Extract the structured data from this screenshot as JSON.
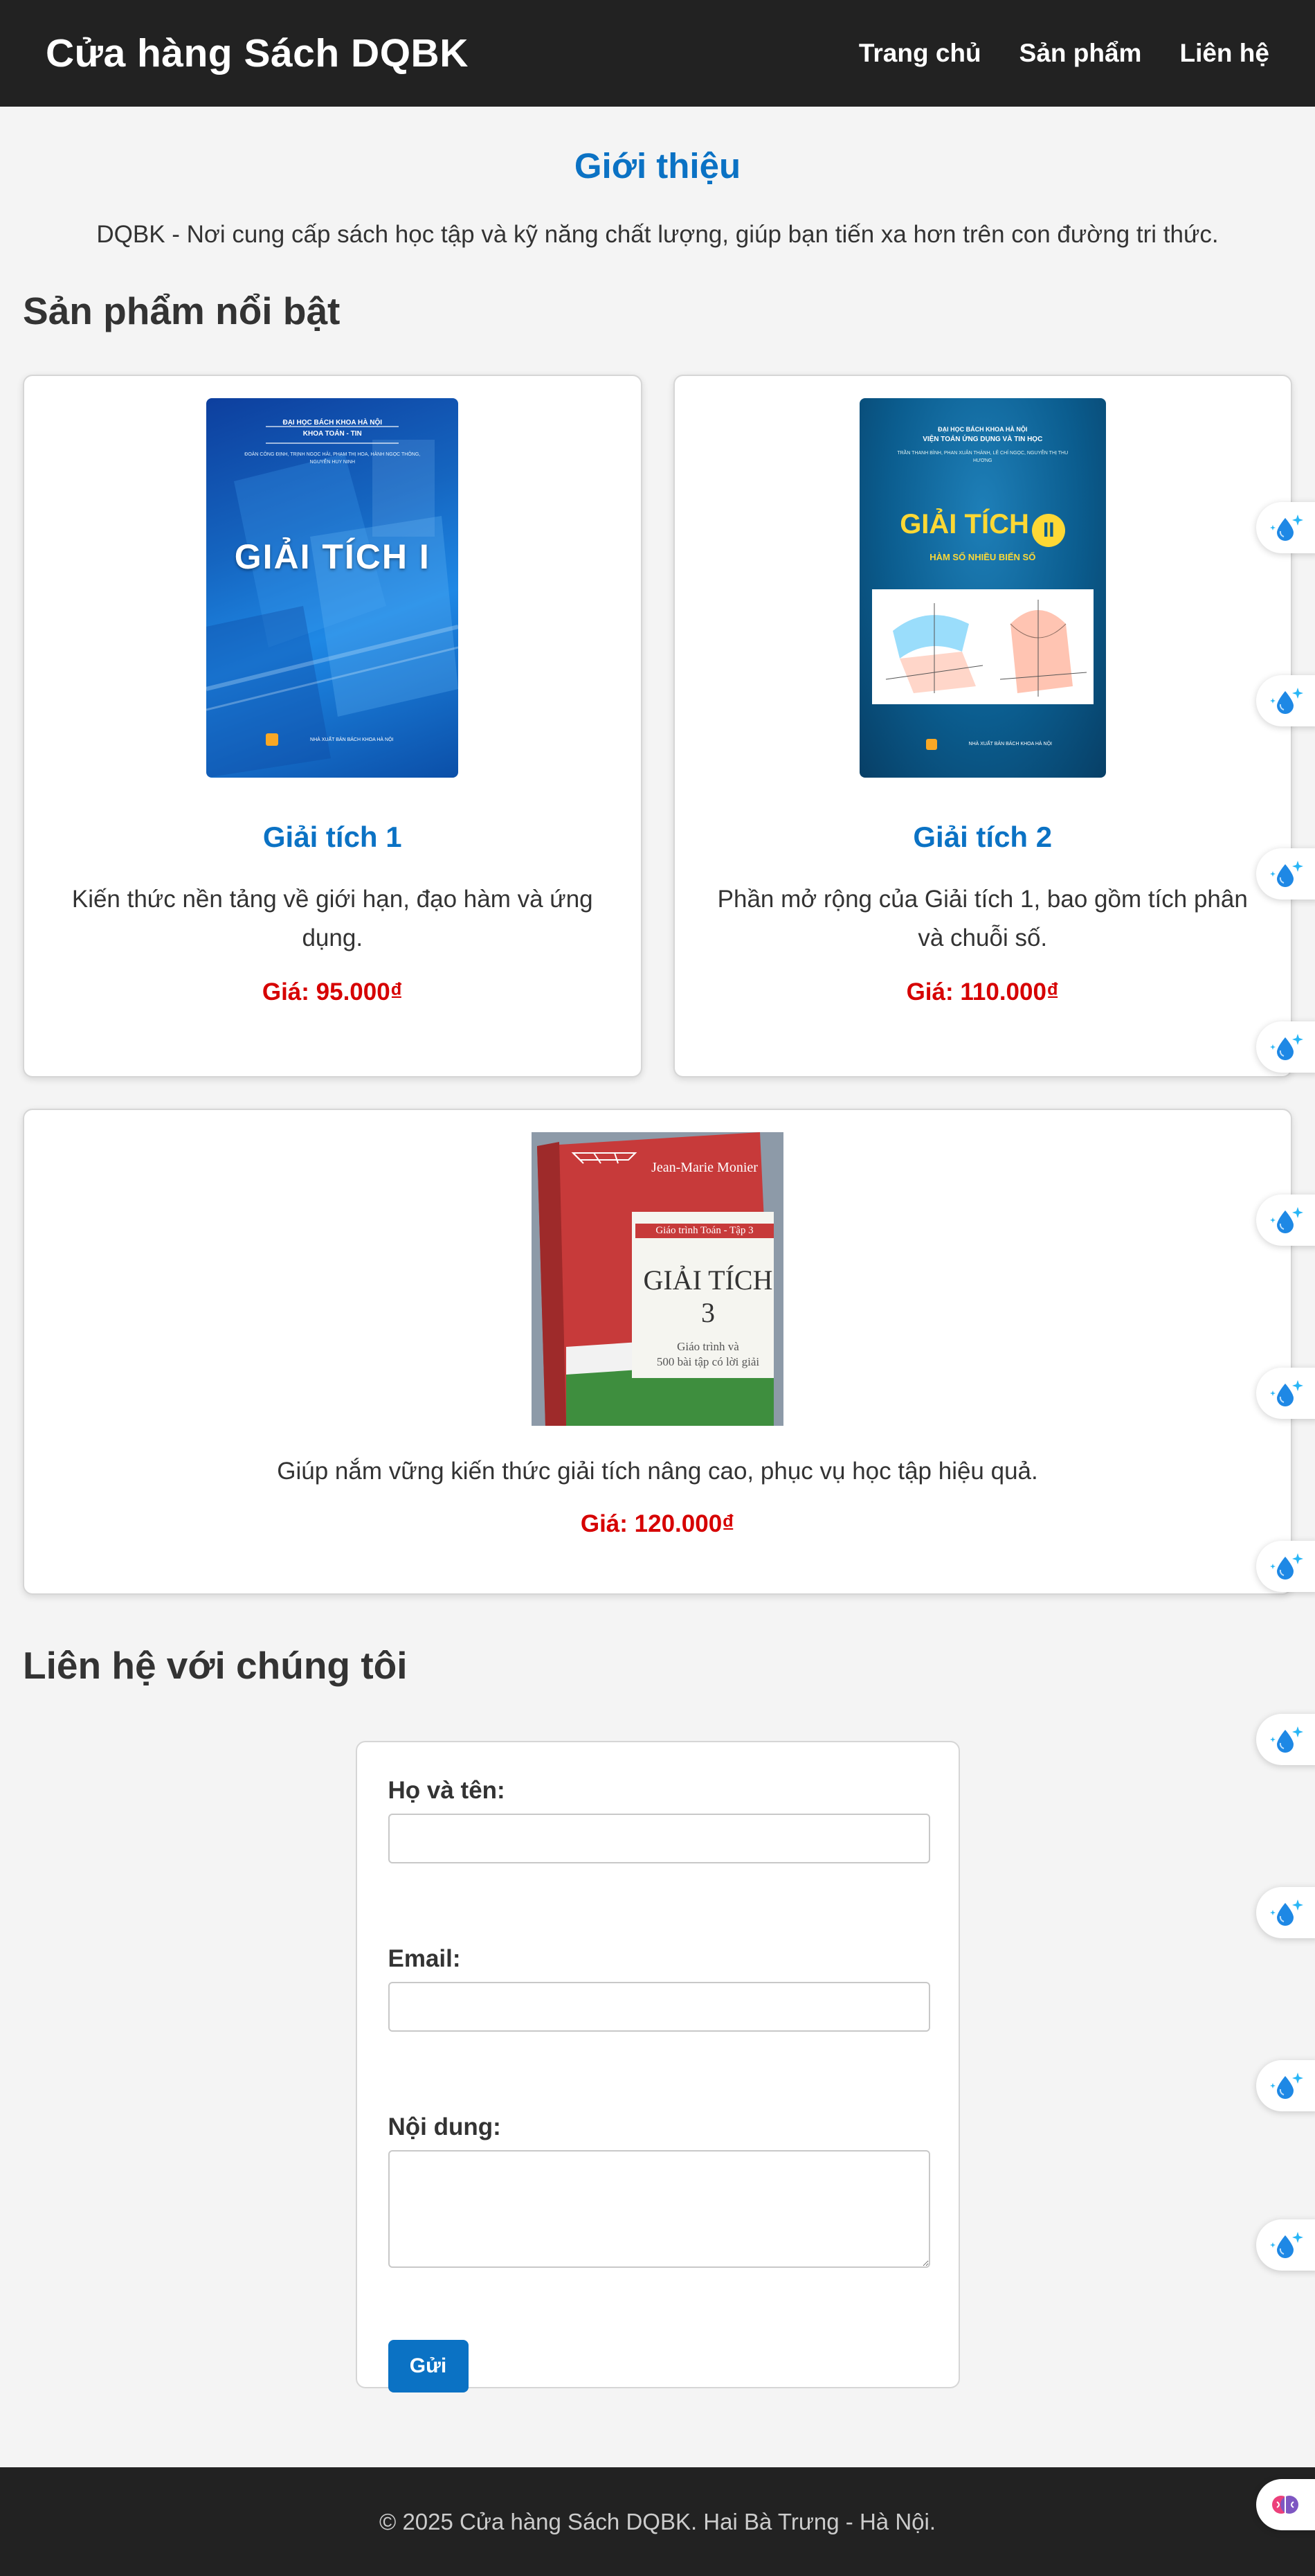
{
  "header": {
    "logo": "Cửa hàng Sách DQBK",
    "nav": [
      "Trang chủ",
      "Sản phẩm",
      "Liên hệ"
    ]
  },
  "intro": {
    "title": "Giới thiệu",
    "text": "DQBK - Nơi cung cấp sách học tập và kỹ năng chất lượng, giúp bạn tiến xa hơn trên con đường tri thức."
  },
  "products": {
    "section_title": "Sản phẩm nổi bật",
    "items": [
      {
        "name": "Giải tích 1",
        "description": "Kiến thức nền tảng về giới hạn, đạo hàm và ứng dụng.",
        "price": "Giá: 95.000₫",
        "cover": {
          "publisher_top": "ĐẠI HỌC BÁCH KHOA HÀ NỘI",
          "department": "KHOA TOÁN - TIN",
          "authors": "ĐOÀN CÔNG ĐỊNH, TRỊNH NGỌC HẢI, PHẠM THỊ HOA, HÀNH NGỌC THÔNG, NGUYỄN HUY NINH",
          "title": "GIẢI TÍCH I",
          "publisher_bottom": "NHÀ XUẤT BẢN BÁCH KHOA HÀ NỘI"
        }
      },
      {
        "name": "Giải tích 2",
        "description": "Phần mở rộng của Giải tích 1, bao gồm tích phân và chuỗi số.",
        "price": "Giá: 110.000₫",
        "cover": {
          "publisher_top": "ĐẠI HỌC BÁCH KHOA HÀ NỘI",
          "department": "VIỆN TOÁN ỨNG DỤNG VÀ TIN HỌC",
          "authors": "TRẦN THANH BÌNH, PHAN XUÂN THÀNH, LÊ CHÍ NGỌC, NGUYỄN THỊ THU HƯƠNG",
          "title": "GIẢI TÍCH",
          "title_badge": "II",
          "subtitle": "HÀM SỐ NHIỀU BIẾN SỐ",
          "publisher_bottom": "NHÀ XUẤT BẢN BÁCH KHOA HÀ NỘI"
        }
      },
      {
        "name": "",
        "description": "Giúp nắm vững kiến thức giải tích nâng cao, phục vụ học tập hiệu quả.",
        "price": "Giá: 120.000₫",
        "cover": {
          "author": "Jean-Marie Monier",
          "series": "Giáo trình Toán - Tập 3",
          "title": "GIẢI TÍCH 3",
          "subtitle_line1": "Giáo trình và",
          "subtitle_line2": "500 bài tập có lời giải"
        }
      }
    ]
  },
  "contact": {
    "section_title": "Liên hệ với chúng tôi",
    "name_label": "Họ và tên:",
    "email_label": "Email:",
    "message_label": "Nội dung:",
    "submit_label": "Gửi"
  },
  "footer": {
    "text": "© 2025 Cửa hàng Sách DQBK. Hai Bà Trưng - Hà Nội."
  },
  "floating_widgets": {
    "icon": "water-drop-sparkle-icon",
    "count": 11,
    "bottom_icon": "brain-icon"
  },
  "colors": {
    "header_bg": "#222222",
    "accent": "#0b72c4",
    "price": "#d60000",
    "page_bg": "#f4f4f4"
  }
}
